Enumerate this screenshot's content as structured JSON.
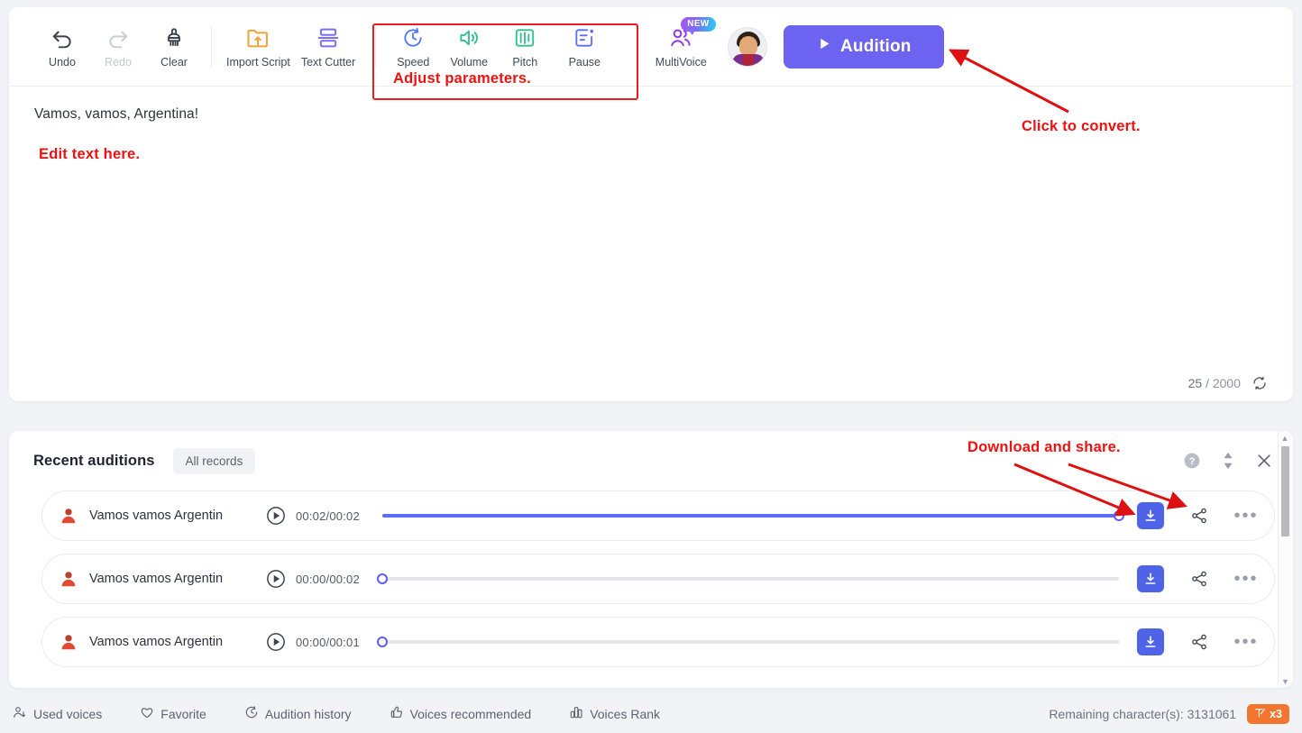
{
  "toolbar": {
    "items": [
      {
        "label": "Undo",
        "icon": "undo-icon",
        "disabled": false
      },
      {
        "label": "Redo",
        "icon": "redo-icon",
        "disabled": true
      },
      {
        "label": "Clear",
        "icon": "clear-brush-icon",
        "disabled": false
      },
      {
        "label": "Import Script",
        "icon": "import-folder-icon",
        "disabled": false
      },
      {
        "label": "Text Cutter",
        "icon": "text-cutter-icon",
        "disabled": false
      }
    ],
    "params": [
      {
        "label": "Speed",
        "icon": "speed-clock-icon"
      },
      {
        "label": "Volume",
        "icon": "volume-speaker-icon"
      },
      {
        "label": "Pitch",
        "icon": "pitch-sliders-icon"
      },
      {
        "label": "Pause",
        "icon": "pause-card-icon"
      }
    ],
    "multivoice": {
      "label": "MultiVoice",
      "badge": "NEW",
      "icon": "multivoice-people-icon"
    },
    "audition_label": "Audition"
  },
  "editor": {
    "text": "Vamos, vamos, Argentina!",
    "count_current": "25",
    "count_separator": "/",
    "count_max": "2000",
    "refresh_icon": "refresh-icon"
  },
  "annotations": {
    "adjust": "Adjust parameters.",
    "edit": "Edit text here.",
    "convert": "Click to convert.",
    "download": "Download and share."
  },
  "panel": {
    "title": "Recent auditions",
    "chip": "All records",
    "actions": [
      {
        "name": "help-icon"
      },
      {
        "name": "sort-updown-icon"
      },
      {
        "name": "close-icon"
      }
    ],
    "rows": [
      {
        "name": "Vamos vamos Argentin",
        "time": "00:02/00:02",
        "progress": 100
      },
      {
        "name": "Vamos vamos Argentin",
        "time": "00:00/00:02",
        "progress": 0
      },
      {
        "name": "Vamos vamos Argentin",
        "time": "00:00/00:01",
        "progress": 0
      }
    ]
  },
  "bottom": {
    "items": [
      {
        "label": "Used voices",
        "icon": "used-voices-icon"
      },
      {
        "label": "Favorite",
        "icon": "heart-icon"
      },
      {
        "label": "Audition history",
        "icon": "history-clock-icon"
      },
      {
        "label": "Voices recommended",
        "icon": "thumbs-up-icon"
      },
      {
        "label": "Voices Rank",
        "icon": "rank-bars-icon"
      }
    ],
    "remaining": "Remaining character(s): 3131061",
    "multiplier": "x3"
  },
  "colors": {
    "accent": "#6c63f0",
    "annotation_red": "#ee1111",
    "badge_orange": "#f2762f",
    "track_fill": "#5b6ef5"
  }
}
